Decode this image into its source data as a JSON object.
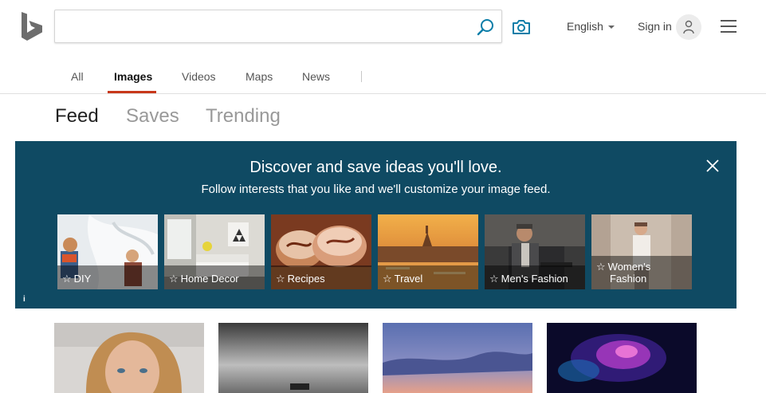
{
  "header": {
    "search": {
      "value": "",
      "placeholder": ""
    },
    "language_label": "English",
    "signin_label": "Sign in"
  },
  "nav": {
    "tabs": [
      {
        "label": "All"
      },
      {
        "label": "Images",
        "active": true
      },
      {
        "label": "Videos"
      },
      {
        "label": "Maps"
      },
      {
        "label": "News"
      }
    ]
  },
  "subtabs": [
    {
      "label": "Feed",
      "active": true
    },
    {
      "label": "Saves"
    },
    {
      "label": "Trending"
    }
  ],
  "banner": {
    "title": "Discover and save ideas you'll love.",
    "subtitle": "Follow interests that you like and we'll customize your image feed.",
    "info_label": "i",
    "background": "#0f4a63",
    "tiles": [
      {
        "label": "DIY",
        "icon": "star-outline-icon"
      },
      {
        "label": "Home Decor",
        "icon": "star-outline-icon"
      },
      {
        "label": "Recipes",
        "icon": "star-outline-icon"
      },
      {
        "label": "Travel",
        "icon": "star-outline-icon"
      },
      {
        "label": "Men's Fashion",
        "icon": "star-outline-icon"
      },
      {
        "label": "Women's Fashion",
        "label_line1": "Women's",
        "label_line2": "Fashion",
        "icon": "star-outline-icon"
      }
    ]
  },
  "colors": {
    "accent": "#c8381a",
    "search_icon": "#0b7da8"
  }
}
